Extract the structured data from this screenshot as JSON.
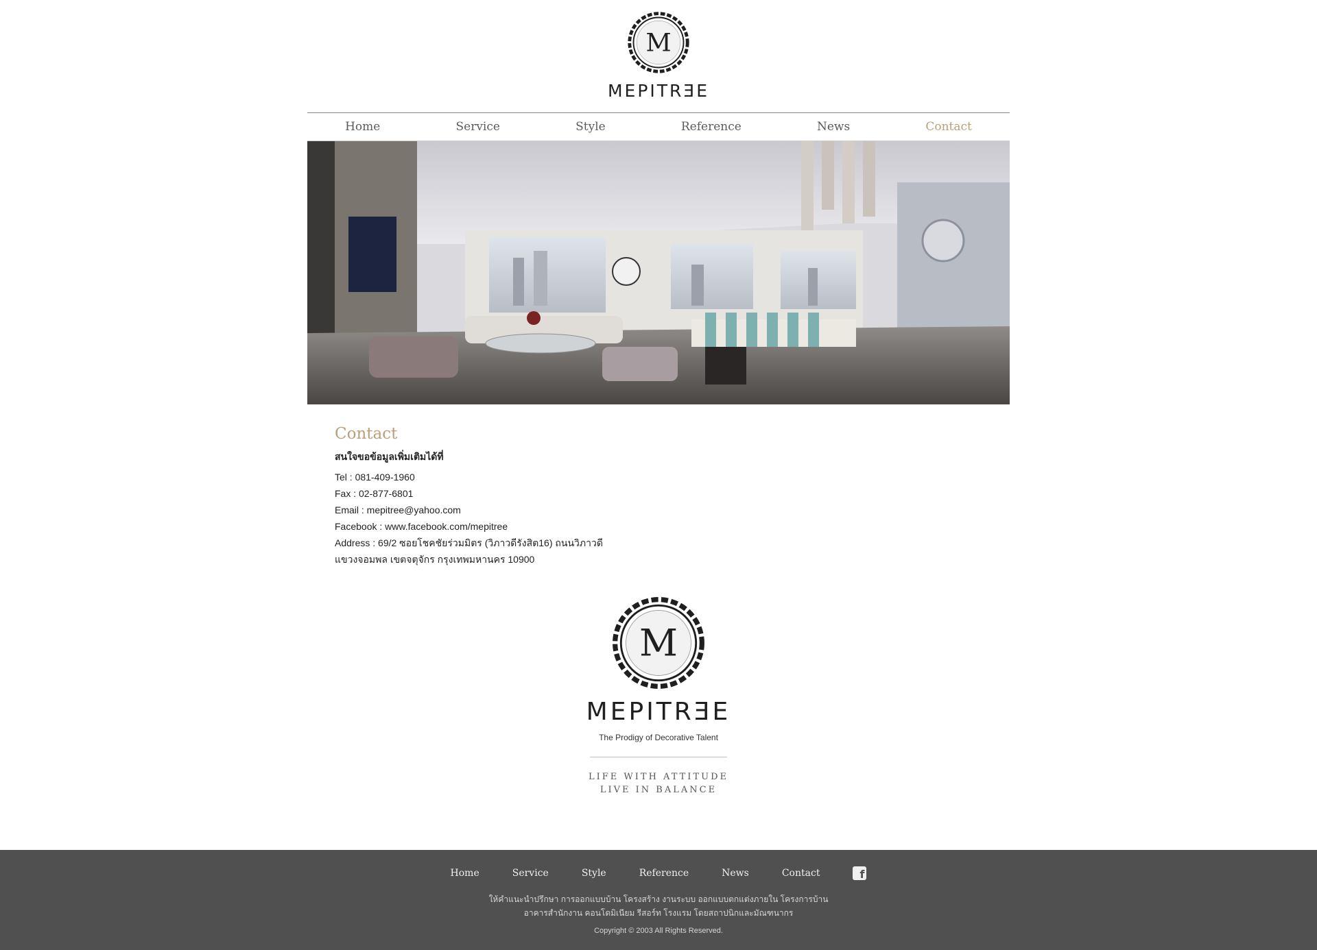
{
  "header": {
    "wordmark": "MEPITRƎE"
  },
  "nav": {
    "items": [
      "Home",
      "Service",
      "Style",
      "Reference",
      "News",
      "Contact"
    ],
    "active": "Contact"
  },
  "content": {
    "title": "Contact",
    "lead": "สนใจขอข้อมูลเพิ่มเติมได้ที่",
    "tel": "Tel : 081-409-1960",
    "fax": "Fax : 02-877-6801",
    "email": "Email : mepitree@yahoo.com",
    "facebook": "Facebook : www.facebook.com/mepitree",
    "address1": "Address : 69/2 ซอยโชคชัยร่วมมิตร (วิภาวดีรังสิต16) ถนนวิภาวดี",
    "address2": "แขวงจอมพล เขตจตุจักร กรุงเทพมหานคร 10900"
  },
  "brand": {
    "wordmark": "MEPITRƎE",
    "tagline": "The Prodigy of Decorative Talent",
    "motto1": "LIFE WITH ATTITUDE",
    "motto2": "LIVE IN BALANCE"
  },
  "footer": {
    "nav": [
      "Home",
      "Service",
      "Style",
      "Reference",
      "News",
      "Contact"
    ],
    "facebook_icon": "facebook-icon",
    "desc1": "ให้คำแนะนำปรึกษา การออกแบบบ้าน โครงสร้าง งานระบบ ออกแบบตกแต่งภายใน โครงการบ้าน",
    "desc2": "อาคารสำนักงาน คอนโดมิเนียม รีสอร์ท โรงแรม โดยสถาปนิกและมัณฑนากร",
    "copyright": "Copyright © 2003 All Rights Reserved."
  },
  "colors": {
    "accent": "#b9a07a",
    "footer_bg": "#505050"
  }
}
